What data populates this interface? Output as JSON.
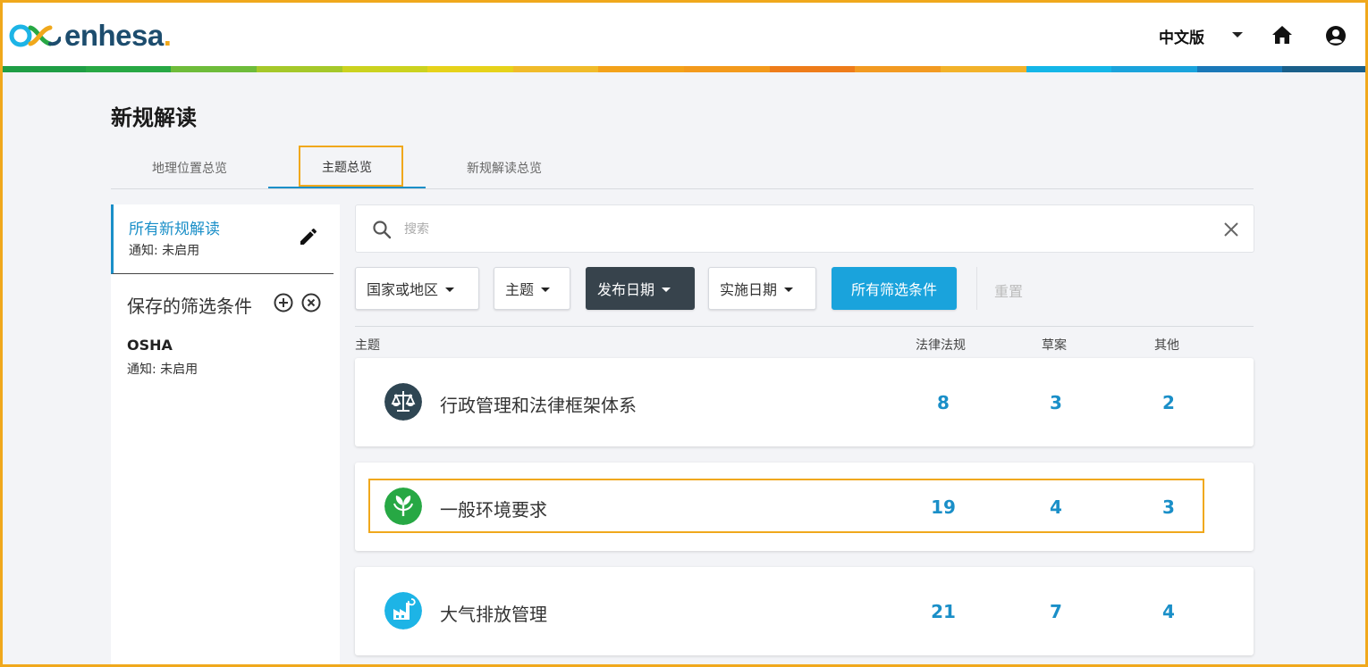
{
  "brand": {
    "name": "enhesa",
    "dot": "."
  },
  "header": {
    "language": "中文版"
  },
  "page": {
    "title": "新规解读"
  },
  "tabs": [
    {
      "label": "地理位置总览"
    },
    {
      "label": "主题总览"
    },
    {
      "label": "新规解读总览"
    }
  ],
  "sidebar": {
    "active": {
      "title": "所有新规解读",
      "subtitle": "通知: 未启用"
    },
    "saved_title": "保存的筛选条件",
    "saved_items": [
      {
        "title": "OSHA",
        "subtitle": "通知: 未启用"
      }
    ]
  },
  "search": {
    "placeholder": "搜索"
  },
  "filters": {
    "country": "国家或地区",
    "topic": "主题",
    "publish_date": "发布日期",
    "effective_date": "实施日期",
    "all_filters": "所有筛选条件",
    "reset": "重置"
  },
  "table": {
    "columns": {
      "topic": "主题",
      "laws": "法律法规",
      "drafts": "草案",
      "other": "其他"
    },
    "rows": [
      {
        "title": "行政管理和法律框架体系",
        "laws": "8",
        "drafts": "3",
        "other": "2",
        "icon": "scales-icon",
        "color": "#2f4653"
      },
      {
        "title": "一般环境要求",
        "laws": "19",
        "drafts": "4",
        "other": "3",
        "icon": "leaf-icon",
        "color": "#27a844"
      },
      {
        "title": "大气排放管理",
        "laws": "21",
        "drafts": "7",
        "other": "4",
        "icon": "factory-icon",
        "color": "#1db4e6"
      }
    ]
  },
  "colors": {
    "accent": "#1a8fc8",
    "primary_button": "#1aa3dc",
    "dark_button": "#37434c",
    "highlight": "#f0a81c"
  }
}
